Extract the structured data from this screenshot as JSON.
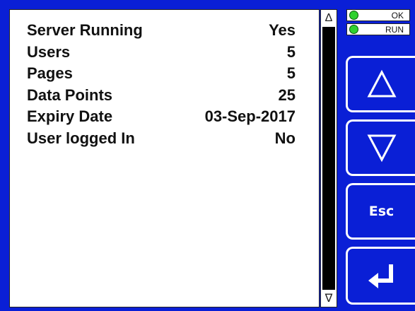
{
  "info_rows": [
    {
      "label": "Server Running",
      "value": "Yes"
    },
    {
      "label": "Users",
      "value": "5"
    },
    {
      "label": "Pages",
      "value": "5"
    },
    {
      "label": "Data Points",
      "value": "25"
    },
    {
      "label": "Expiry Date",
      "value": "03-Sep-2017"
    },
    {
      "label": "User logged In",
      "value": "No"
    }
  ],
  "scrollbar": {
    "up_glyph": "Δ",
    "down_glyph": "∇"
  },
  "status": {
    "ok_label": "OK",
    "run_label": "RUN"
  },
  "buttons": {
    "esc_label": "Esc"
  },
  "colors": {
    "background": "#0a1fd6",
    "led_on": "#2fd12f",
    "panel": "#ffffff"
  }
}
